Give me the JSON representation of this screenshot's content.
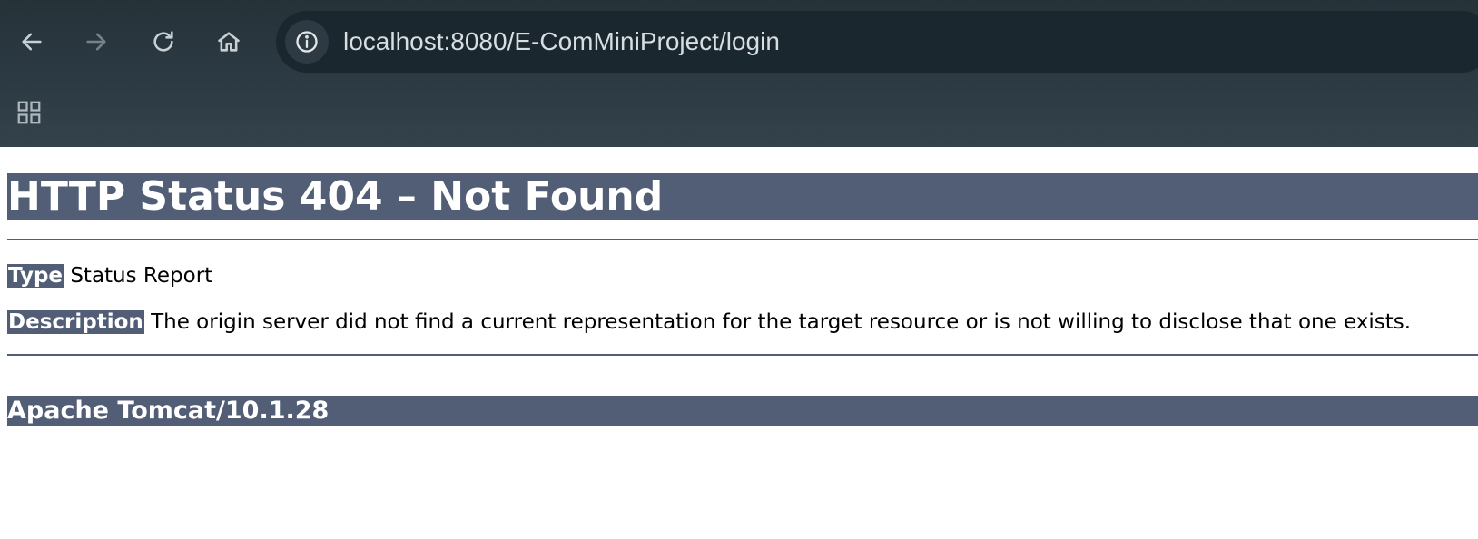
{
  "browser": {
    "url": "localhost:8080/E-ComMiniProject/login",
    "icons": [
      "back-arrow-icon",
      "forward-arrow-icon",
      "reload-icon",
      "home-icon",
      "info-icon",
      "apps-grid-icon"
    ],
    "colors": {
      "chrome_background": "#2c3a44",
      "address_bar": "#1a272f",
      "url_text": "#d7dde1"
    }
  },
  "page": {
    "heading": "HTTP Status 404 – Not Found",
    "type_label": "Type",
    "type_value": "Status Report",
    "description_label": "Description",
    "description_value": "The origin server did not find a current representation for the target resource or is not willing to disclose that one exists.",
    "server": "Apache Tomcat/10.1.28",
    "colors": {
      "accent": "#525d76",
      "accent_text": "#ffffff",
      "body_text": "#000000"
    }
  }
}
